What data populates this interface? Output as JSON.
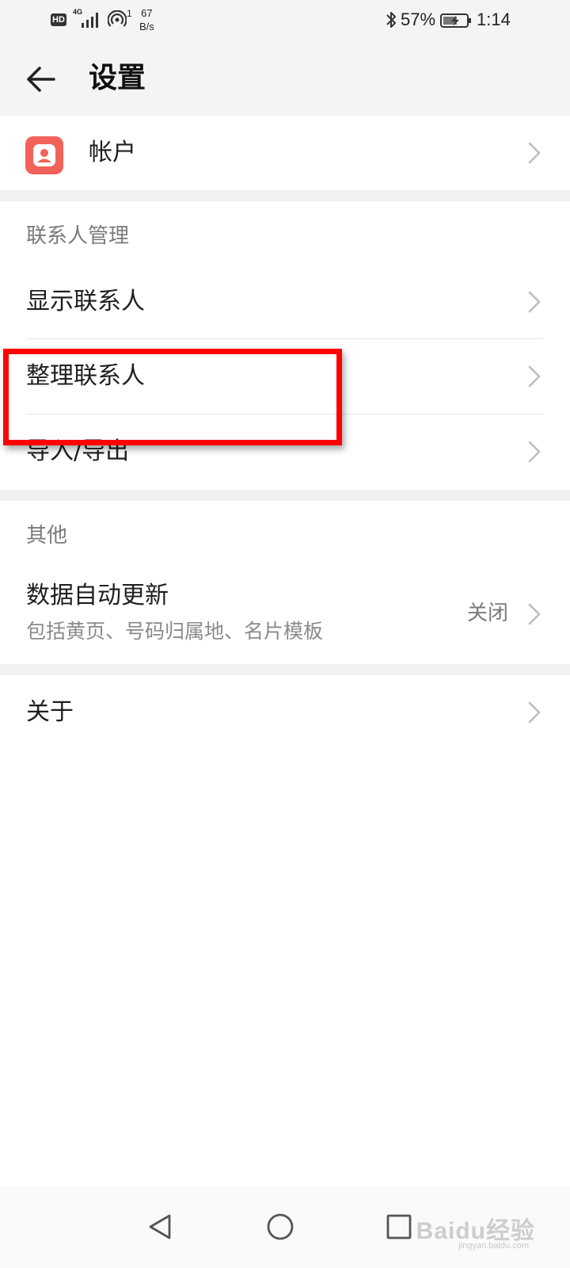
{
  "status_bar": {
    "hd": "HD",
    "network": "4G",
    "hotspot_count": "1",
    "speed_value": "67",
    "speed_unit": "B/s",
    "battery": "57%",
    "time": "1:14"
  },
  "header": {
    "title": "设置",
    "back_icon": "back-arrow-icon"
  },
  "account": {
    "label": "帐户",
    "icon": "account-icon",
    "icon_color": "#f0625a"
  },
  "contacts_section": {
    "title": "联系人管理",
    "items": [
      {
        "label": "显示联系人"
      },
      {
        "label": "整理联系人"
      },
      {
        "label": "导入/导出"
      }
    ]
  },
  "other_section": {
    "title": "其他",
    "auto_update": {
      "label": "数据自动更新",
      "sub": "包括黄页、号码归属地、名片模板",
      "value": "关闭"
    }
  },
  "about": {
    "label": "关于"
  },
  "highlight_color": "#ff0000",
  "watermark": {
    "text": "Baidu经验",
    "sub": "jingyan.baidu.com"
  }
}
